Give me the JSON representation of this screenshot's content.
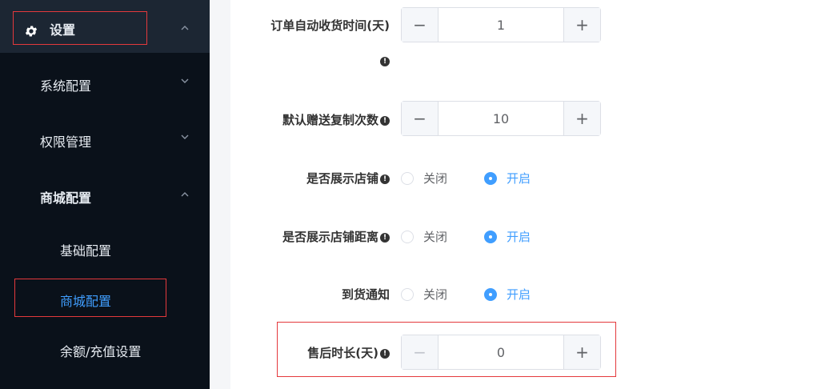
{
  "sidebar": {
    "top": {
      "label": "设置",
      "icon": "gear-icon",
      "expanded": true
    },
    "items": [
      {
        "label": "系统配置",
        "expanded": false
      },
      {
        "label": "权限管理",
        "expanded": false
      },
      {
        "label": "商城配置",
        "expanded": true
      }
    ],
    "subitems": [
      {
        "label": "基础配置",
        "active": false
      },
      {
        "label": "商城配置",
        "active": true
      },
      {
        "label": "余额/充值设置",
        "active": false
      }
    ]
  },
  "form": {
    "auto_receive": {
      "label": "订单自动收货时间(天)",
      "value": "1"
    },
    "gift_copy": {
      "label": "默认赠送复制次数",
      "value": "10"
    },
    "show_store": {
      "label": "是否展示店铺",
      "options": [
        "关闭",
        "开启"
      ],
      "selected": "开启"
    },
    "show_distance": {
      "label": "是否展示店铺距离",
      "options": [
        "关闭",
        "开启"
      ],
      "selected": "开启"
    },
    "arrival_notice": {
      "label": "到货通知",
      "options": [
        "关闭",
        "开启"
      ],
      "selected": "开启"
    },
    "after_sale": {
      "label": "售后时长(天)",
      "value": "0"
    }
  },
  "icons": {
    "info": "!",
    "minus": "−",
    "plus": "+"
  },
  "colors": {
    "sidebar_bg": "#0f1720",
    "accent": "#409eff",
    "highlight": "#e4393c"
  }
}
